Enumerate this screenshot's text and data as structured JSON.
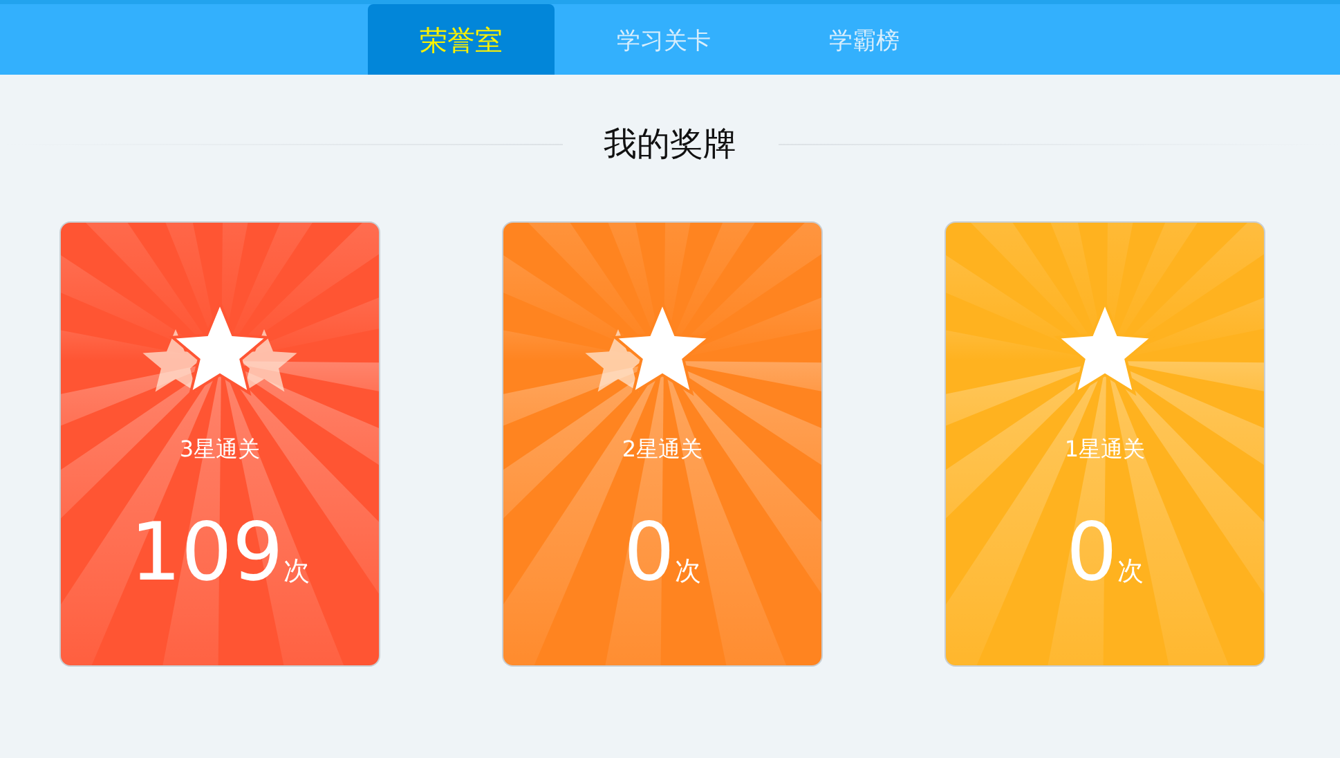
{
  "tabs": [
    {
      "label": "荣誉室",
      "selected": true
    },
    {
      "label": "学习关卡",
      "selected": false
    },
    {
      "label": "学霸榜",
      "selected": false
    }
  ],
  "section_title": "我的奖牌",
  "medals": [
    {
      "label": "3星通关",
      "count": "109",
      "unit": "次",
      "kind": "three",
      "color": "#ff5533"
    },
    {
      "label": "2星通关",
      "count": "0",
      "unit": "次",
      "kind": "two",
      "color": "#ff8420"
    },
    {
      "label": "1星通关",
      "count": "0",
      "unit": "次",
      "kind": "one",
      "color": "#ffb21f"
    }
  ]
}
